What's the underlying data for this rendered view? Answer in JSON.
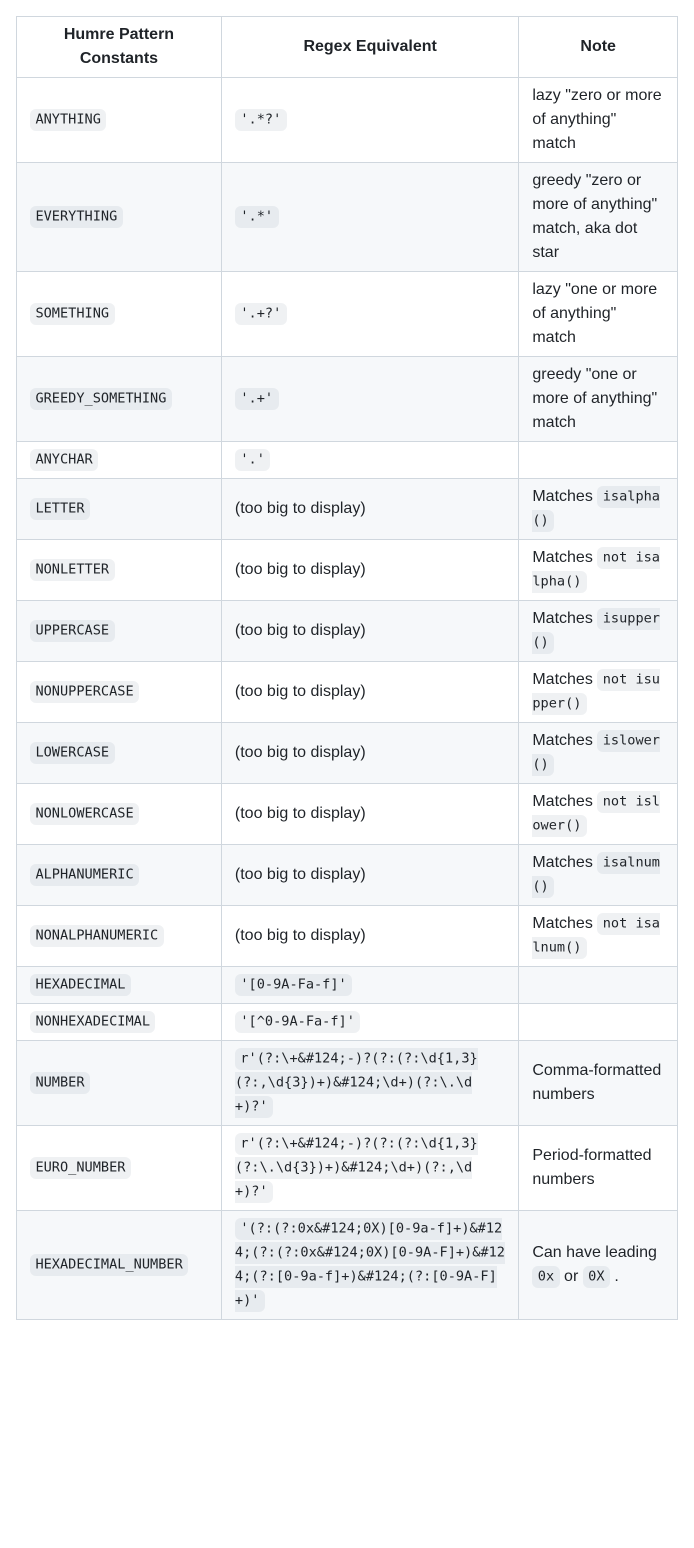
{
  "table": {
    "headers": {
      "c1": "Humre Pattern Constants",
      "c2": "Regex Equivalent",
      "c3": "Note"
    },
    "rows": [
      {
        "const": "ANYTHING",
        "regex_code": "'.*?'",
        "regex_text": "",
        "note_pre": "lazy \"zero or more of anything\" match",
        "note_code1": "",
        "note_mid": "",
        "note_code2": "",
        "note_post": ""
      },
      {
        "const": "EVERYTHING",
        "regex_code": "'.*'",
        "regex_text": "",
        "note_pre": "greedy \"zero or more of anything\" match, aka dot star",
        "note_code1": "",
        "note_mid": "",
        "note_code2": "",
        "note_post": ""
      },
      {
        "const": "SOMETHING",
        "regex_code": "'.+?'",
        "regex_text": "",
        "note_pre": "lazy \"one or more of anything\" match",
        "note_code1": "",
        "note_mid": "",
        "note_code2": "",
        "note_post": ""
      },
      {
        "const": "GREEDY_SOMETHING",
        "regex_code": "'.+'",
        "regex_text": "",
        "note_pre": "greedy \"one or more of anything\" match",
        "note_code1": "",
        "note_mid": "",
        "note_code2": "",
        "note_post": ""
      },
      {
        "const": "ANYCHAR",
        "regex_code": "'.'",
        "regex_text": "",
        "note_pre": "",
        "note_code1": "",
        "note_mid": "",
        "note_code2": "",
        "note_post": ""
      },
      {
        "const": "LETTER",
        "regex_code": "",
        "regex_text": "(too big to display)",
        "note_pre": "Matches ",
        "note_code1": "isalpha()",
        "note_mid": "",
        "note_code2": "",
        "note_post": ""
      },
      {
        "const": "NONLETTER",
        "regex_code": "",
        "regex_text": "(too big to display)",
        "note_pre": "Matches ",
        "note_code1": "not isalpha()",
        "note_mid": "",
        "note_code2": "",
        "note_post": ""
      },
      {
        "const": "UPPERCASE",
        "regex_code": "",
        "regex_text": "(too big to display)",
        "note_pre": "Matches ",
        "note_code1": "isupper()",
        "note_mid": "",
        "note_code2": "",
        "note_post": ""
      },
      {
        "const": "NONUPPERCASE",
        "regex_code": "",
        "regex_text": "(too big to display)",
        "note_pre": "Matches ",
        "note_code1": "not isupper()",
        "note_mid": "",
        "note_code2": "",
        "note_post": ""
      },
      {
        "const": "LOWERCASE",
        "regex_code": "",
        "regex_text": "(too big to display)",
        "note_pre": "Matches ",
        "note_code1": "islower()",
        "note_mid": "",
        "note_code2": "",
        "note_post": ""
      },
      {
        "const": "NONLOWERCASE",
        "regex_code": "",
        "regex_text": "(too big to display)",
        "note_pre": "Matches ",
        "note_code1": "not islower()",
        "note_mid": "",
        "note_code2": "",
        "note_post": ""
      },
      {
        "const": "ALPHANUMERIC",
        "regex_code": "",
        "regex_text": "(too big to display)",
        "note_pre": "Matches ",
        "note_code1": "isalnum()",
        "note_mid": "",
        "note_code2": "",
        "note_post": ""
      },
      {
        "const": "NONALPHANUMERIC",
        "regex_code": "",
        "regex_text": "(too big to display)",
        "note_pre": "Matches ",
        "note_code1": "not isalnum()",
        "note_mid": "",
        "note_code2": "",
        "note_post": ""
      },
      {
        "const": "HEXADECIMAL",
        "regex_code": "'[0-9A-Fa-f]'",
        "regex_text": "",
        "note_pre": "",
        "note_code1": "",
        "note_mid": "",
        "note_code2": "",
        "note_post": ""
      },
      {
        "const": "NONHEXADECIMAL",
        "regex_code": "'[^0-9A-Fa-f]'",
        "regex_text": "",
        "note_pre": "",
        "note_code1": "",
        "note_mid": "",
        "note_code2": "",
        "note_post": ""
      },
      {
        "const": "NUMBER",
        "regex_code": "r'(?:\\+&#124;-)?(?:(?:\\d{1,3}(?:,\\d{3})+)&#124;\\d+)(?:\\.\\d+)?'",
        "regex_text": "",
        "note_pre": "Comma-formatted numbers",
        "note_code1": "",
        "note_mid": "",
        "note_code2": "",
        "note_post": ""
      },
      {
        "const": "EURO_NUMBER",
        "regex_code": "r'(?:\\+&#124;-)?(?:(?:\\d{1,3}(?:\\.\\d{3})+)&#124;\\d+)(?:,\\d+)?'",
        "regex_text": "",
        "note_pre": "Period-formatted numbers",
        "note_code1": "",
        "note_mid": "",
        "note_code2": "",
        "note_post": ""
      },
      {
        "const": "HEXADECIMAL_NUMBER",
        "regex_code": "'(?:(?:0x&#124;0X)[0-9a-f]+)&#124;(?:(?:0x&#124;0X)[0-9A-F]+)&#124;(?:[0-9a-f]+)&#124;(?:[0-9A-F]+)'",
        "regex_text": "",
        "note_pre": "Can have leading ",
        "note_code1": "0x",
        "note_mid": " or ",
        "note_code2": "0X",
        "note_post": " ."
      }
    ]
  }
}
